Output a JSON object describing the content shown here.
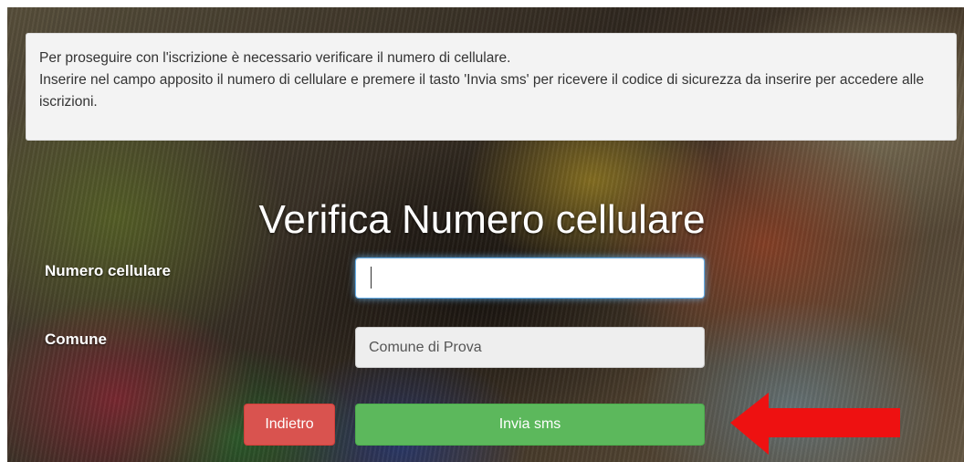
{
  "notice": {
    "line1": "Per proseguire con l'iscrizione è necessario verificare il numero di cellulare.",
    "line2": "Inserire nel campo apposito il numero di cellulare e premere il tasto 'Invia sms' per ricevere il codice di sicurezza da inserire per accedere alle iscrizioni."
  },
  "title": "Verifica Numero cellulare",
  "form": {
    "phone_label": "Numero cellulare",
    "phone_value": "",
    "comune_label": "Comune",
    "comune_value": "Comune di Prova"
  },
  "buttons": {
    "back_label": "Indietro",
    "send_label": "Invia sms"
  },
  "colors": {
    "back_button": "#d9534f",
    "send_button": "#5cb85c",
    "annotation_arrow": "#ee1111"
  },
  "icons": {
    "annotation": "red-arrow-left-icon"
  }
}
